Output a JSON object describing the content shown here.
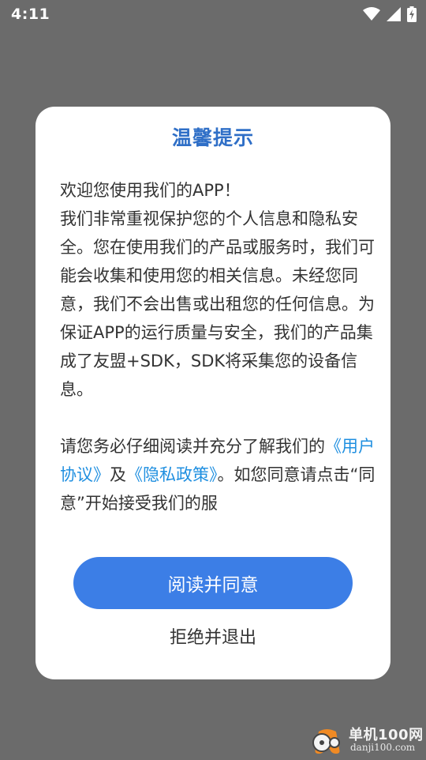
{
  "status_bar": {
    "time": "4:11",
    "icons": [
      "wifi-icon",
      "signal-icon",
      "battery-charging-icon"
    ]
  },
  "dialog": {
    "title": "温馨提示",
    "intro_line": "欢迎您使用我们的APP！",
    "body_text": "我们非常重视保护您的个人信息和隐私安全。您在使用我们的产品或服务时，我们可能会收集和使用您的相关信息。未经您同意，我们不会出售或出租您的任何信息。为保证APP的运行质量与安全，我们的产品集成了友盟+SDK，SDK将采集您的设备信息。",
    "notice_prefix": "请您务必仔细阅读并充分了解我们的",
    "user_agreement_link": "《用户协议》",
    "conjunction": "及",
    "privacy_policy_link": "《隐私政策》",
    "notice_suffix": "。如您同意请点击“同意”开始接受我们的服",
    "agree_button": "阅读并同意",
    "reject_button": "拒绝并退出"
  },
  "watermark": {
    "name": "单机100网",
    "url": "danji100.com"
  },
  "colors": {
    "overlay": "#6b6b6b",
    "title": "#2f6fc7",
    "link": "#1f8fe0",
    "button": "#3c7ee6"
  }
}
